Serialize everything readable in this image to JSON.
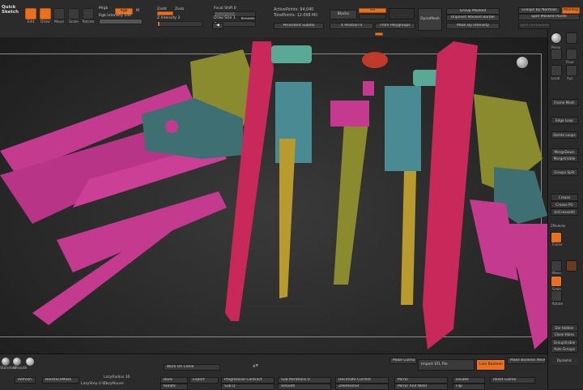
{
  "top_shelf": {
    "quick_sketch": "Quick Sketch",
    "tools": [
      {
        "label": "Edit",
        "active": true
      },
      {
        "label": "Draw",
        "active": true
      },
      {
        "label": "Move",
        "active": false
      },
      {
        "label": "Scale",
        "active": false
      },
      {
        "label": "Rotate",
        "active": false
      }
    ],
    "mrgb": "Mrgb",
    "rgb": "Rgb",
    "m": "M",
    "rgb_intensity": "Rgb Intensity 100",
    "zadd": "Zadd",
    "zsub": "Zsub",
    "z_intensity": "Z Intensity 2",
    "focal_shift": "Focal Shift 0",
    "draw_size": "Draw Size 1",
    "dynamic": "Dynamic",
    "active_points": "ActivePoints: 94,040",
    "total_points": "TotalPoints: 12.098 Mil",
    "persistent_subdiv": "Persistent Subdiv",
    "blocks": "Blocks",
    "pin": "Pin",
    "gizmo_label": "X Position 0",
    "from_polygroups": "From Polygroups",
    "dynamesh": "DynaMesh",
    "group_masked": "Group Masked",
    "groups_by_normals": "Groups By Normals",
    "maxdeg": "Maxdeg",
    "unpolish_masked_border": "Unpolish Masked Border",
    "split_masked_points": "Split Masked Points",
    "mask_by_intensity": "Mask By Intensity",
    "split_unmasked": "Split Unmasked",
    "back_arrow": "◀"
  },
  "right_tray": {
    "buttons": [
      "Frame Mesh",
      "Edge Loop",
      "Delete Loops",
      "MergeDown",
      "MergeVisible",
      "Groups Split",
      "Crease",
      "Crease PG",
      "UnCreaseAll",
      "Del Hidden",
      "Close Holes",
      "GroupVisible",
      "Auto Groups",
      "Dynamic"
    ],
    "persp": "Persp",
    "floor": "Floor",
    "local": "Local",
    "xyz": "Xyz",
    "frame": "Frame",
    "zmodeler": "ZModeler",
    "move_label": "Move",
    "scale_label": "Scale",
    "rotate_label": "Rotate"
  },
  "bottom_shelf": {
    "brush_names": [
      "Standard",
      "Smooth",
      "Snake"
    ],
    "work_on_clone": "Work On Clone",
    "refresh": "Refresh",
    "backface_mask": "BackfaceMask",
    "lazy_radius": "LazyRadius 36",
    "lazy_step": "LazyStep 0.05",
    "lazy_mouse": "LazyMouse",
    "back": "Back",
    "rotate_label": "Rotate",
    "export": "Export",
    "progressive_contract": "Progressive Contract",
    "sub_d": "Sub D",
    "sub_d_iterations": "Sub Iterations 0",
    "smooth": "Smooth",
    "decimate_current": "Decimate Current",
    "mirror": "Mirror",
    "mirror_and_weld": "Mirror And Weld",
    "double": "Double",
    "flip": "Flip",
    "zremesher": "ZRemesher",
    "reset_gizmo": "Reset Gizmo",
    "make_gizmo": "Make Gizmo",
    "import_stl": "Import STL file",
    "live_boolean": "Live Boolean",
    "make_boolean_mesh": "Make Boolean Mesh",
    "up_down_arrows": "▲▼"
  },
  "colors": {
    "accent": "#e8701e",
    "panel": "#2b2b2b",
    "magenta": "#c43a8f",
    "crimson": "#c8285a",
    "olive": "#8a8a2e",
    "teal": "#4a8a92",
    "gold": "#b89a2e"
  }
}
